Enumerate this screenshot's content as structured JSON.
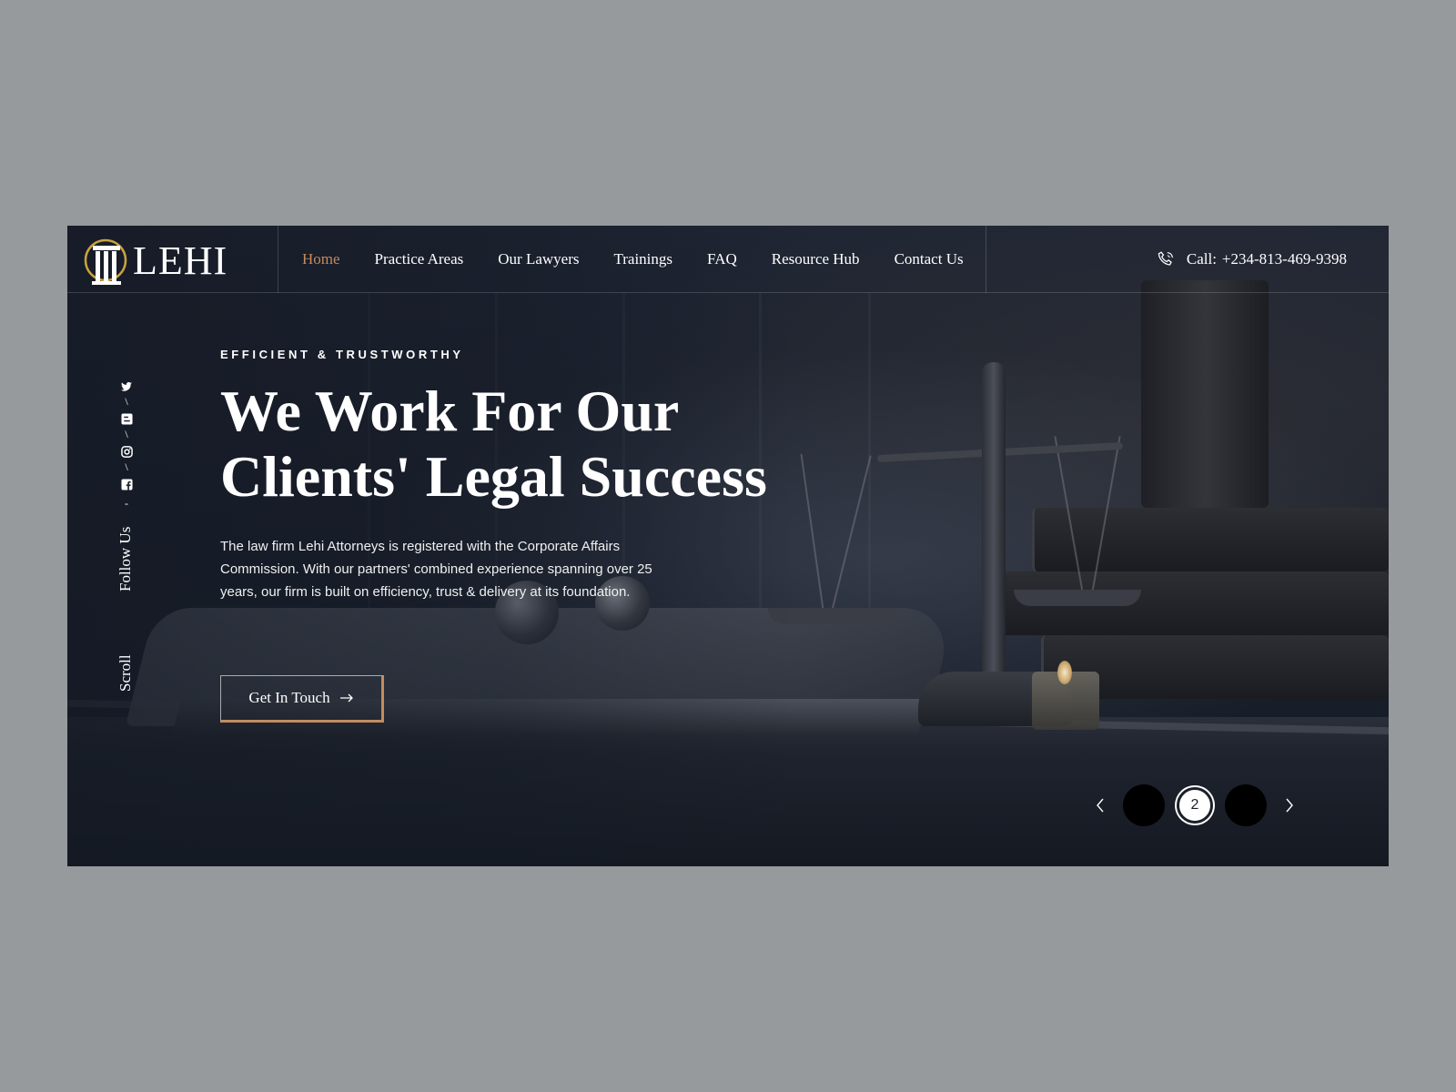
{
  "brand": {
    "name": "LEHI",
    "accent": "#c38c5e"
  },
  "nav": {
    "items": [
      {
        "label": "Home",
        "active": true
      },
      {
        "label": "Practice Areas",
        "active": false
      },
      {
        "label": "Our Lawyers",
        "active": false
      },
      {
        "label": "Trainings",
        "active": false
      },
      {
        "label": "FAQ",
        "active": false
      },
      {
        "label": "Resource Hub",
        "active": false
      },
      {
        "label": "Contact Us",
        "active": false
      }
    ]
  },
  "call": {
    "label": "Call:",
    "number": "+234-813-469-9398",
    "icon": "phone-icon"
  },
  "side": {
    "social_icons": [
      "twitter-icon",
      "blogger-icon",
      "instagram-icon",
      "facebook-icon"
    ],
    "follow_label": "Follow Us",
    "scroll_label": "Scroll"
  },
  "hero": {
    "eyebrow": "EFFICIENT & TRUSTWORTHY",
    "title_line1": "We Work For Our",
    "title_line2": "Clients' Legal Success",
    "description": "The law firm Lehi Attorneys is registered with the Corporate Affairs Commission. With our partners' combined experience spanning over 25 years, our firm is built on efficiency, trust & delivery at its foundation.",
    "cta_label": "Get In Touch",
    "cta_icon": "arrow-right-icon"
  },
  "slider": {
    "prev_icon": "chevron-left-icon",
    "next_icon": "chevron-right-icon",
    "current_label": "2"
  },
  "colors": {
    "page_bg": "#979a9d",
    "hero_bg": "#1a202c",
    "text": "#ffffff"
  }
}
